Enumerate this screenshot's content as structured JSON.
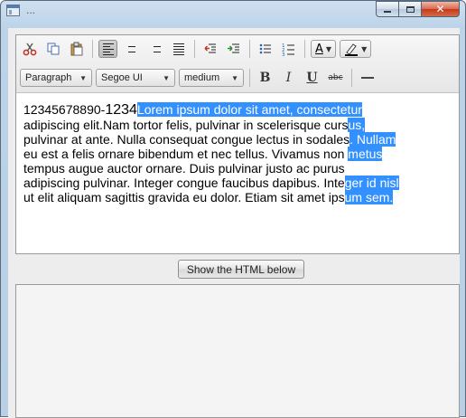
{
  "window": {
    "title": "..."
  },
  "toolbar": {
    "paragraph_format": "Paragraph",
    "font_family": "Segoe UI",
    "font_size": "medium",
    "bold_label": "B",
    "italic_label": "I",
    "underline_label": "U",
    "strike_label": "abc",
    "text_color_label": "A"
  },
  "icons": {
    "cut": "cut-icon",
    "copy": "copy-icon",
    "paste": "paste-icon",
    "align_left": "align-left-icon",
    "align_center": "align-center-icon",
    "align_right": "align-right-icon",
    "align_justify": "align-justify-icon",
    "outdent": "outdent-icon",
    "indent": "indent-icon",
    "bullets": "bullet-list-icon",
    "numbers": "numbered-list-icon",
    "text_color": "text-color-icon",
    "highlight": "highlight-icon",
    "hr": "horizontal-rule-icon"
  },
  "editor": {
    "text_small": "12345678890-",
    "text_large": "1234",
    "lines": [
      {
        "plain": "",
        "selected": "Lorem ipsum dolor sit amet, consectetur"
      },
      {
        "plain": "adipiscing elit.Nam tortor felis, pulvinar in scelerisque curs",
        "selected": "us,"
      },
      {
        "plain": "pulvinar at ante. Nulla consequat congue lectus in sodales",
        "selected": ". Nullam"
      },
      {
        "plain": "eu est a felis ornare bibendum et nec tellus. Vivamus non ",
        "selected": "metus"
      },
      {
        "plain": "tempus augue auctor ornare. Duis pulvinar justo ac purus",
        "selected": ""
      },
      {
        "plain": "adipiscing pulvinar. Integer congue faucibus dapibus. Inte",
        "selected": "ger id nisl"
      },
      {
        "plain": "ut elit aliquam sagittis gravida eu dolor. Etiam sit amet ips",
        "selected": "um sem."
      }
    ]
  },
  "show_html_button": "Show the HTML below",
  "colors": {
    "selection": "#3390ff",
    "close_button": "#c4391d",
    "window_frame": "#bcd3e8"
  }
}
